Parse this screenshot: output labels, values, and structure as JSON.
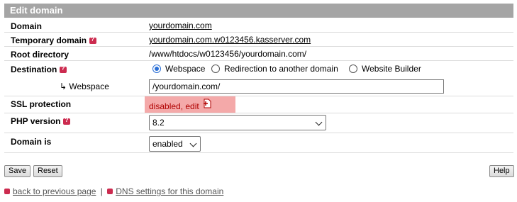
{
  "header": {
    "title": "Edit domain"
  },
  "rows": {
    "domain": {
      "label": "Domain",
      "value": "yourdomain.com"
    },
    "temp_domain": {
      "label": "Temporary domain",
      "value": "yourdomain.com.w0123456.kasserver.com"
    },
    "root_dir": {
      "label": "Root directory",
      "value": "/www/htdocs/w0123456/yourdomain.com/"
    },
    "destination": {
      "label": "Destination",
      "options": [
        "Webspace",
        "Redirection to another domain",
        "Website Builder"
      ],
      "selected": "Webspace"
    },
    "webspace": {
      "label": "↳ Webspace",
      "value": "/yourdomain.com/"
    },
    "ssl": {
      "label": "SSL protection",
      "value": "disabled, edit"
    },
    "php": {
      "label": "PHP version",
      "value": "8.2"
    },
    "domain_is": {
      "label": "Domain is",
      "value": "enabled"
    }
  },
  "buttons": {
    "save": "Save",
    "reset": "Reset",
    "help": "Help"
  },
  "footer": {
    "back": "back to previous page",
    "separator": "|",
    "dns": "DNS settings for this domain"
  },
  "colors": {
    "header_bg": "#a5a5a5",
    "ssl_bg": "#f4a9a9",
    "help_icon": "#cc2b4f",
    "radio_accent": "#2a6fd6"
  }
}
